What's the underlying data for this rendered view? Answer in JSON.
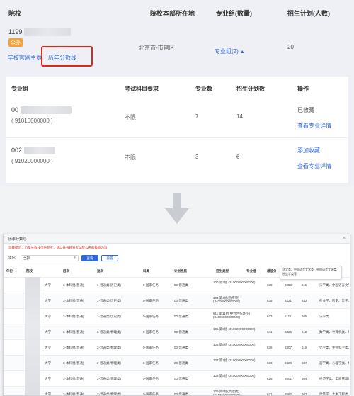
{
  "top": {
    "headers": {
      "school": "院校",
      "location": "院校本部所在地",
      "group_count": "专业组(数量)",
      "plan": "招生计划(人数)"
    },
    "school": {
      "id_prefix": "1199",
      "badge": "公办",
      "official_site_link": "学校官网主页",
      "history_score_link": "历年分数线",
      "location": "北京市-市辖区",
      "group_count_link": "专业组(2)",
      "plan": "20"
    },
    "sub_table": {
      "headers": {
        "group": "专业组",
        "subjects": "考试科目要求",
        "major_count": "专业数",
        "plan": "招生计划数",
        "ops": "操作"
      },
      "rows": [
        {
          "code_prefix": "00",
          "code_full": "( 91010000000 )",
          "subjects": "不限",
          "major_count": "7",
          "plan": "14",
          "status": "已收藏",
          "detail_link": "查看专业详情"
        },
        {
          "code_prefix": "002",
          "code_full": "( 91020000000 )",
          "subjects": "不限",
          "major_count": "3",
          "plan": "6",
          "status": "添加收藏",
          "detail_link": "查看专业详情"
        }
      ]
    }
  },
  "arrow_color": "#c9ccd1",
  "modal": {
    "title": "历年分数线",
    "close": "×",
    "warning": "温馨提示：历年分数线仅供参考，请以各省教育考试院公布的数据为准",
    "filter_label": "年份:",
    "filter_value": "全部",
    "query_button": "查询",
    "reset_button": "重置",
    "tooltip": "法学类、中国语言文学类、外国语言文学类、社会学类等",
    "headers": [
      "年份",
      "院校",
      "层次",
      "批次",
      "科类",
      "计划性质",
      "招生类型",
      "专业组",
      "最低分",
      "最低位次",
      "平均分",
      "备注"
    ],
    "rows": [
      [
        "",
        "大学",
        "3-本科批(普通)",
        "1-普通类(历史类)",
        "0-国家任务",
        "00-普通类",
        "100 第3组 (31000000000000)",
        "639",
        "8050",
        "615",
        "法学类、中国语言文学类、外国语言文学类"
      ],
      [
        "",
        "大学",
        "3-本科批(普通)",
        "1-普通类(历史类)",
        "0-国家任务",
        "00-普通类",
        "104 第4组(含专项) (34000000000000)",
        "635",
        "8221",
        "632",
        "社会学、历史、哲学、经济学类等"
      ],
      [
        "",
        "大学",
        "3-本科批(普通)",
        "1-普通类(历史类)",
        "0-国家任务",
        "00-普通类",
        "611 第11组(中外合作办学) (34000000000000)",
        "623",
        "8111",
        "605",
        "法学类"
      ],
      [
        "",
        "大学",
        "3-本科批(普通)",
        "2-普通类(物理类)",
        "0-国家任务",
        "00-普通类",
        "105 第5组 (31000000000000)",
        "641",
        "8325",
        "618",
        "数学类、计算机类、电子信息类、机械类"
      ],
      [
        "",
        "大学",
        "3-本科批(普通)",
        "2-普通类(物理类)",
        "0-国家任务",
        "00-普通类",
        "106 第6组 (31000000000000)",
        "636",
        "8307",
        "616",
        "化学类、生物科学类、环境科学类"
      ],
      [
        "",
        "大学",
        "3-本科批(普通)",
        "2-普通类(物理类)",
        "0-国家任务",
        "00-普通类",
        "107 第7组 (31000000000000)",
        "633",
        "8420",
        "607",
        "药学类、心理学类、统计学类"
      ],
      [
        "",
        "大学",
        "3-本科批(普通)",
        "2-普通类(物理类)",
        "0-国家任务",
        "00-普通类",
        "108 第8组 (31000000000000)",
        "628",
        "8501",
        "604",
        "经济学类、工商管理类"
      ],
      [
        "",
        "大学",
        "3-本科批(普通)",
        "2-普通类(物理类)",
        "0-国家任务",
        "00-普通类",
        "109 第9组(高收费) (31000000000000)",
        "621",
        "8562",
        "603",
        "建筑学、土木工程类"
      ]
    ]
  }
}
